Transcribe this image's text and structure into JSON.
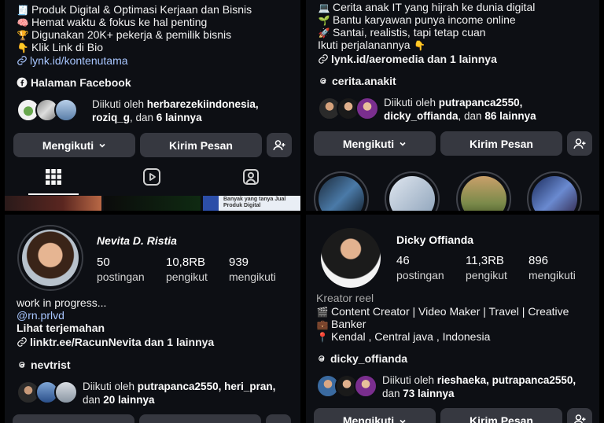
{
  "tl": {
    "bio": [
      {
        "icon": "🧾",
        "icon_name": "receipt-icon",
        "text": "Produk Digital & Optimasi Kerjaan dan Bisnis"
      },
      {
        "icon": "🧠",
        "icon_name": "brain-icon",
        "text": "Hemat waktu & fokus ke hal penting"
      },
      {
        "icon": "🏆",
        "icon_name": "trophy-icon",
        "text": "Digunakan 20K+ pekerja & pemilik bisnis"
      },
      {
        "icon": "👇",
        "icon_name": "pointing-down-icon",
        "text": "Klik Link di Bio"
      }
    ],
    "link": "lynk.id/kontenutama",
    "facebook": "Halaman Facebook",
    "followed_prefix": "Diikuti oleh ",
    "followed_names1": "herbarezekiindonesia,",
    "followed_names2": "roziq_g",
    "followed_mid": ", dan ",
    "followed_count": "6 lainnya",
    "follow_label": "Mengikuti",
    "message_label": "Kirim Pesan",
    "thumb_text": "Banyak yang tanya Jual Produk Digital"
  },
  "tr": {
    "bio": [
      {
        "icon": "💻",
        "icon_name": "laptop-icon",
        "text": "Cerita anak IT yang hijrah ke dunia digital"
      },
      {
        "icon": "🌱",
        "icon_name": "seedling-icon",
        "text": "Bantu karyawan punya income online"
      },
      {
        "icon": "🚀",
        "icon_name": "rocket-icon",
        "text": "Santai, realistis, tapi tetap cuan"
      }
    ],
    "follow_line": "Ikuti perjalanannya",
    "follow_emoji": "👇",
    "link": "lynk.id/aeromedia dan 1 lainnya",
    "threads": "cerita.anakit",
    "followed_prefix": "Diikuti oleh ",
    "followed_names1": "putrapanca2550,",
    "followed_names2": "dicky_offianda",
    "followed_mid": ", dan ",
    "followed_count": "86 lainnya",
    "follow_label": "Mengikuti",
    "message_label": "Kirim Pesan"
  },
  "bl": {
    "name": "Nevita D. Ristia",
    "stats": [
      {
        "num": "50",
        "label": "postingan"
      },
      {
        "num": "10,8RB",
        "label": "pengikut"
      },
      {
        "num": "939",
        "label": "mengikuti"
      }
    ],
    "bio": "work in progress...",
    "mention": "@rn.prlvd",
    "translate": "Lihat terjemahan",
    "link": "linktr.ee/RacunNevita dan 1 lainnya",
    "threads": "nevtrist",
    "followed_prefix": "Diikuti oleh ",
    "followed_names1": "putrapanca2550, heri_pran,",
    "followed_mid": "dan ",
    "followed_count": "20 lainnya"
  },
  "br": {
    "name": "Dicky Offianda",
    "stats": [
      {
        "num": "46",
        "label": "postingan"
      },
      {
        "num": "11,3RB",
        "label": "pengikut"
      },
      {
        "num": "896",
        "label": "mengikuti"
      }
    ],
    "category": "Kreator reel",
    "bio": [
      {
        "icon": "🎬",
        "icon_name": "clapper-icon",
        "text": "Content Creator | Video Maker | Travel | Creative"
      },
      {
        "icon": "💼",
        "icon_name": "briefcase-icon",
        "text": "Banker"
      },
      {
        "icon": "📍",
        "icon_name": "location-pin-icon",
        "text": "Kendal , Central java , Indonesia"
      }
    ],
    "threads": "dicky_offianda",
    "followed_prefix": "Diikuti oleh ",
    "followed_names1": "rieshaeka, putrapanca2550,",
    "followed_mid": "dan ",
    "followed_count": "73 lainnya",
    "follow_label": "Mengikuti",
    "message_label": "Kirim Pesan"
  },
  "colors": {
    "panel_bg": "#0d0f14",
    "button_bg": "#363840",
    "link": "#a8c6ff"
  }
}
